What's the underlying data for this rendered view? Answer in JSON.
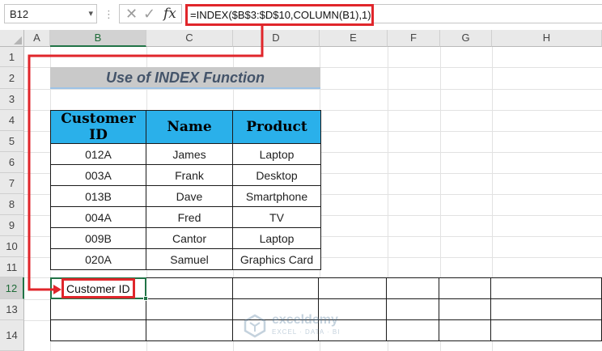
{
  "formula_bar": {
    "name_box": "B12",
    "name_box_arrow": "▾",
    "separator": "⋮",
    "cancel_symbol": "✕",
    "enter_symbol": "✓",
    "fx_label": "fx",
    "formula": "=INDEX($B$3:$D$10,COLUMN(B1),1)"
  },
  "columns": [
    "A",
    "B",
    "C",
    "D",
    "E",
    "F",
    "G",
    "H"
  ],
  "rows": [
    "1",
    "2",
    "3",
    "4",
    "5",
    "6",
    "7",
    "8",
    "9",
    "10",
    "11",
    "12",
    "13",
    "14"
  ],
  "active_cell": "B12",
  "banner": {
    "title": "Use of INDEX Function"
  },
  "table": {
    "headers": [
      "Customer ID",
      "Name",
      "Product"
    ],
    "rows": [
      [
        "012A",
        "James",
        "Laptop"
      ],
      [
        "003A",
        "Frank",
        "Desktop"
      ],
      [
        "013B",
        "Dave",
        "Smartphone"
      ],
      [
        "004A",
        "Fred",
        "TV"
      ],
      [
        "009B",
        "Cantor",
        "Laptop"
      ],
      [
        "020A",
        "Samuel",
        "Graphics Card"
      ]
    ]
  },
  "result": {
    "value": "Customer ID"
  },
  "watermark": {
    "name": "exceldemy",
    "tagline": "EXCEL · DATA · BI"
  },
  "colors": {
    "header_fill": "#2ab0ea",
    "banner_fill": "#c9c9c9",
    "banner_text": "#44546a",
    "highlight_red": "#e0262b",
    "excel_green": "#217346"
  }
}
